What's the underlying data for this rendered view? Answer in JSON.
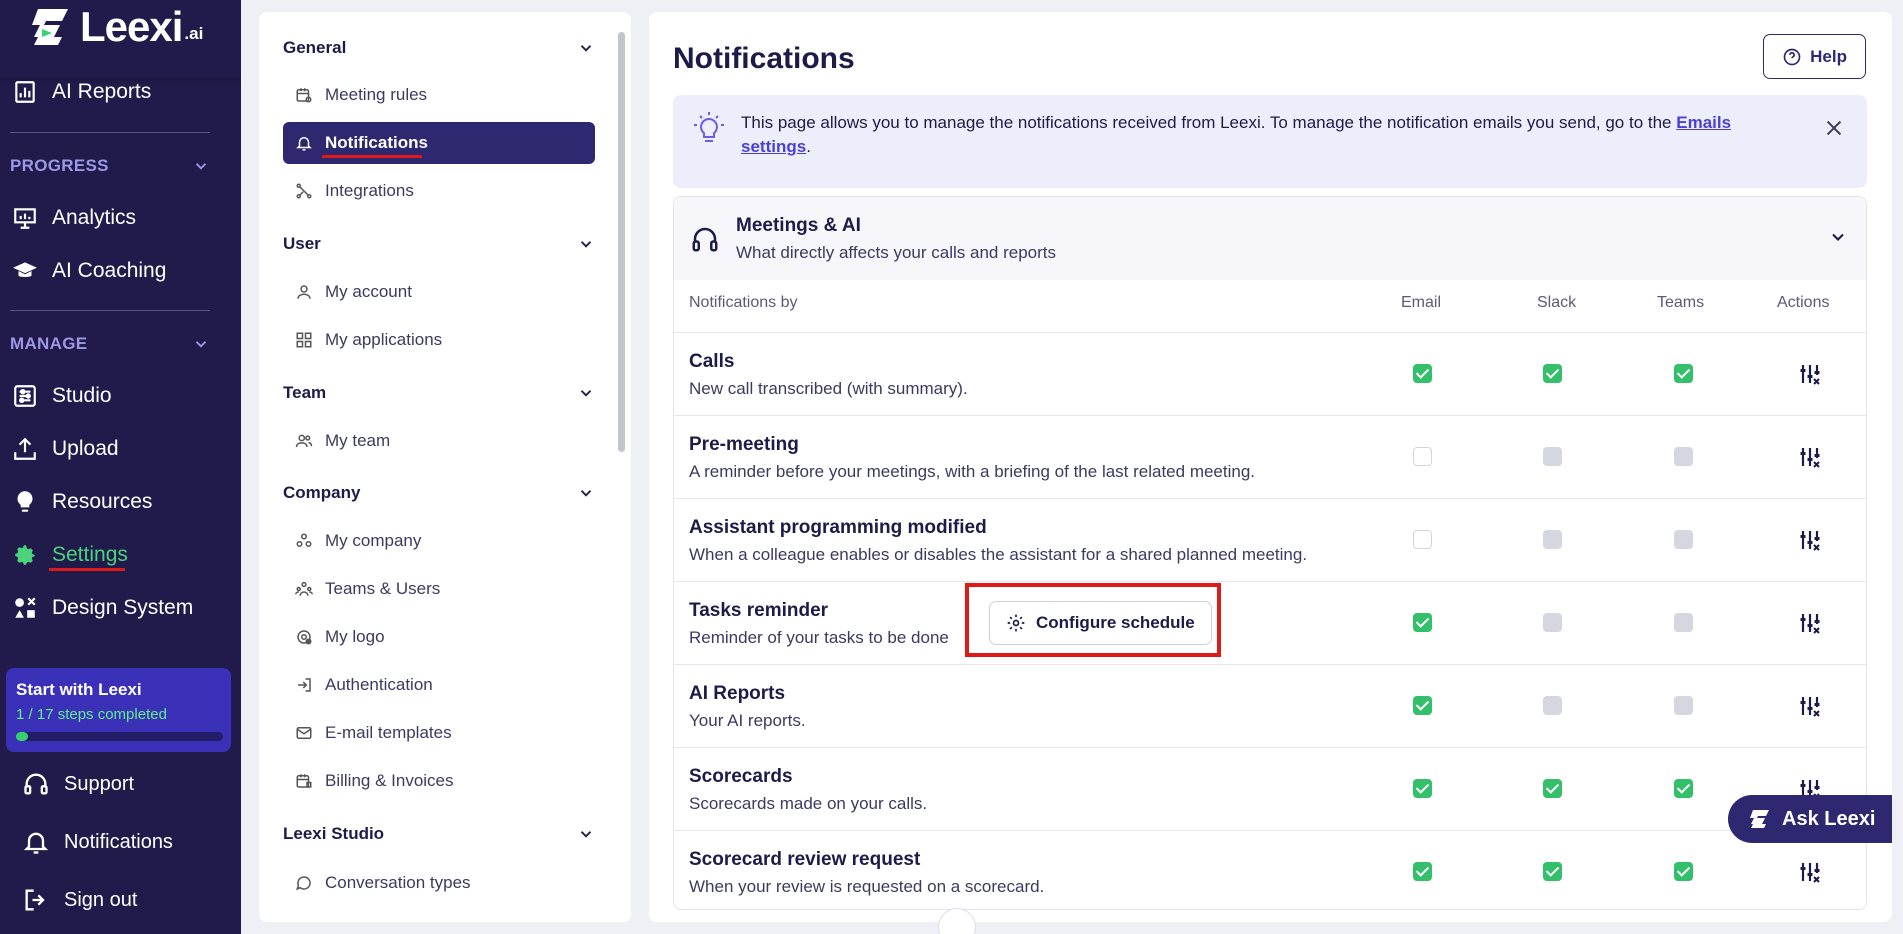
{
  "brand": {
    "name": "Leexi",
    "suffix": ".ai"
  },
  "sidebar": {
    "ai_reports": "AI Reports",
    "progress_label": "PROGRESS",
    "analytics": "Analytics",
    "ai_coaching": "AI Coaching",
    "manage_label": "MANAGE",
    "studio": "Studio",
    "upload": "Upload",
    "resources": "Resources",
    "settings": "Settings",
    "design_system": "Design System",
    "progress_card": {
      "title": "Start with Leexi",
      "subtitle": "1 / 17 steps completed",
      "progress": 0.059
    },
    "support": "Support",
    "notifications": "Notifications",
    "sign_out": "Sign out"
  },
  "menu": {
    "general": "General",
    "meeting_rules": "Meeting rules",
    "notifications": "Notifications",
    "integrations": "Integrations",
    "user": "User",
    "my_account": "My account",
    "my_applications": "My applications",
    "team": "Team",
    "my_team": "My team",
    "company": "Company",
    "my_company": "My company",
    "teams_users": "Teams & Users",
    "my_logo": "My logo",
    "authentication": "Authentication",
    "email_templates": "E-mail templates",
    "billing": "Billing & Invoices",
    "leexi_studio": "Leexi Studio",
    "conversation_types": "Conversation types"
  },
  "main": {
    "title": "Notifications",
    "help": "Help",
    "info": {
      "text": "This page allows you to manage the notifications received from Leexi. To manage the notification emails you send, go to the ",
      "link": "Emails settings",
      "end": "."
    },
    "card": {
      "title": "Meetings & AI",
      "subtitle": "What directly affects your calls and reports",
      "columns": {
        "by": "Notifications by",
        "email": "Email",
        "slack": "Slack",
        "teams": "Teams",
        "actions": "Actions"
      },
      "config_button": "Configure schedule",
      "rows": [
        {
          "title": "Calls",
          "desc": "New call transcribed (with summary).",
          "email": "on",
          "slack": "on",
          "teams": "on"
        },
        {
          "title": "Pre-meeting",
          "desc": "A reminder before your meetings, with a briefing of the last related meeting.",
          "email": "off",
          "slack": "dis",
          "teams": "dis"
        },
        {
          "title": "Assistant programming modified",
          "desc": "When a colleague enables or disables the assistant for a shared planned meeting.",
          "email": "off",
          "slack": "dis",
          "teams": "dis"
        },
        {
          "title": "Tasks reminder",
          "desc": "Reminder of your tasks to be done",
          "email": "on",
          "slack": "dis",
          "teams": "dis"
        },
        {
          "title": "AI Reports",
          "desc": "Your AI reports.",
          "email": "on",
          "slack": "dis",
          "teams": "dis"
        },
        {
          "title": "Scorecards",
          "desc": "Scorecards made on your calls.",
          "email": "on",
          "slack": "on",
          "teams": "on"
        },
        {
          "title": "Scorecard review request",
          "desc": "When your review is requested on a scorecard.",
          "email": "on",
          "slack": "on",
          "teams": "on"
        }
      ]
    },
    "ask_leexi": "Ask Leexi"
  },
  "colors": {
    "sidebar_bg": "#201b4a",
    "accent": "#2e2870",
    "success": "#34c06a",
    "highlight": "#e01919"
  }
}
